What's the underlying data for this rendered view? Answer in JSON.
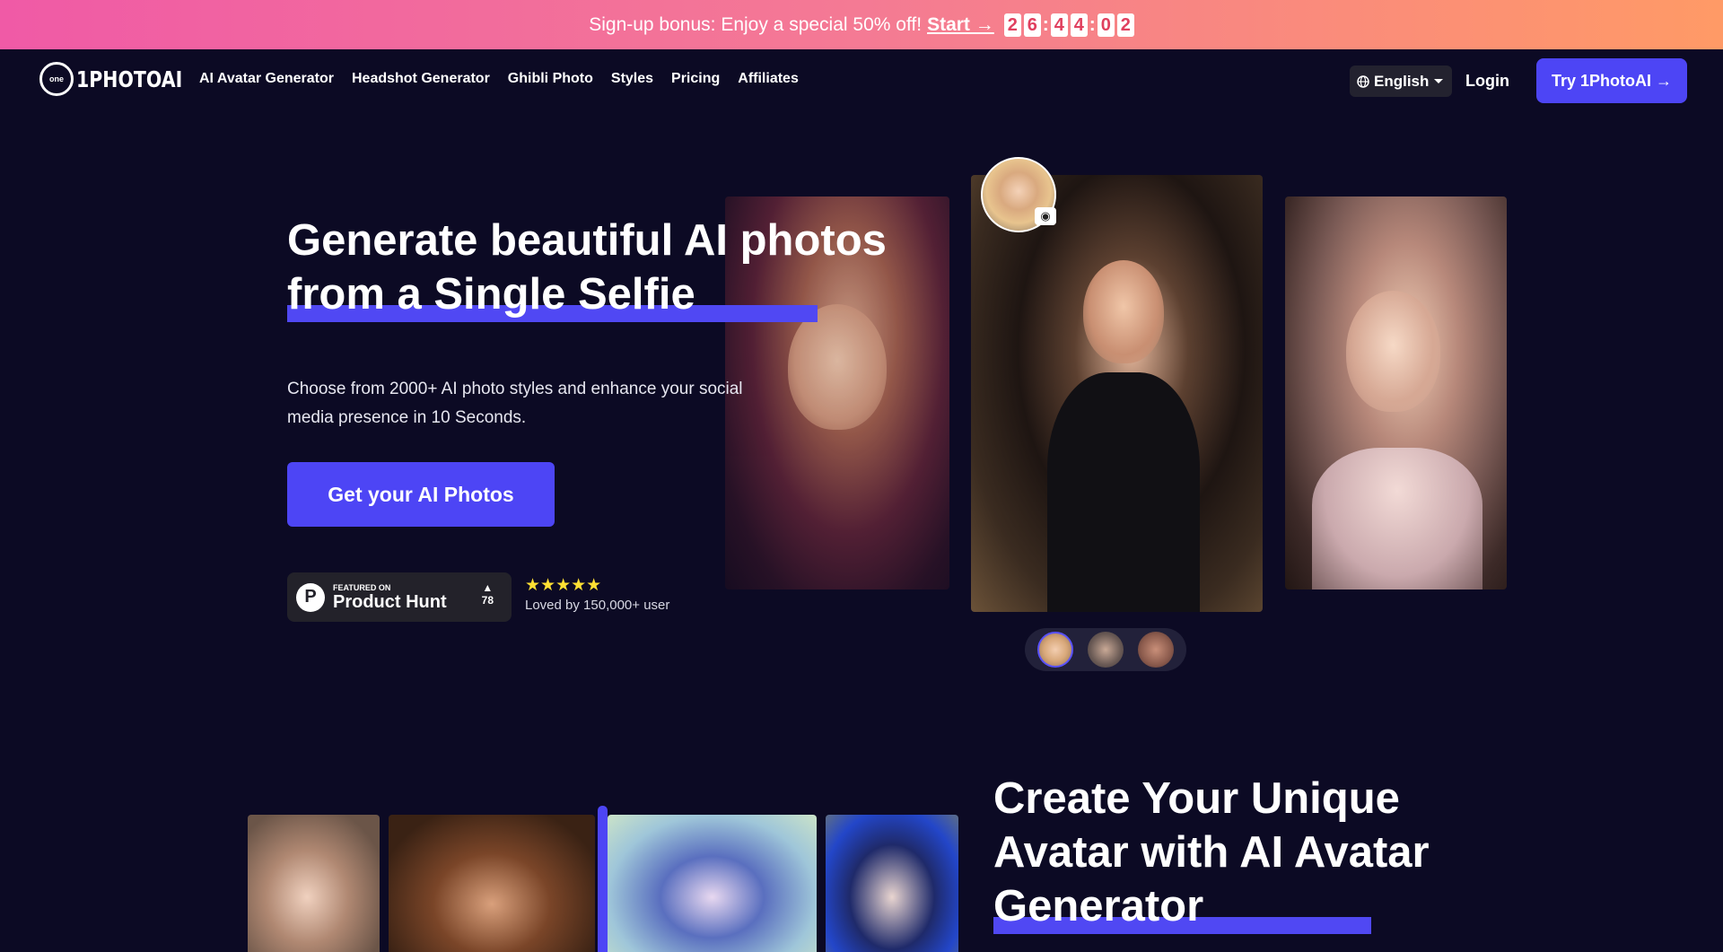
{
  "promo": {
    "text": "Sign-up bonus: Enjoy a special 50% off!",
    "start_label": "Start →",
    "countdown": [
      "2",
      "6",
      "4",
      "4",
      "0",
      "2"
    ]
  },
  "nav": {
    "logo_text": "1PHOTOAI",
    "logo_mark": "one",
    "links": [
      "AI Avatar Generator",
      "Headshot Generator",
      "Ghibli Photo",
      "Styles",
      "Pricing",
      "Affiliates"
    ],
    "language": "English",
    "login": "Login",
    "try_button": "Try 1PhotoAI →"
  },
  "hero": {
    "title_line1": "Generate beautiful AI photos",
    "title_line2": "from a Single Selfie",
    "subtitle": "Choose from 2000+ AI photo styles and enhance your social media presence in 10 Seconds.",
    "cta": "Get your AI Photos",
    "product_hunt": {
      "featured": "FEATURED ON",
      "name": "Product Hunt",
      "logo": "P",
      "upvote_icon": "▲",
      "count": "78"
    },
    "stars": "★★★★★",
    "loved": "Loved by 150,000+ user"
  },
  "section2": {
    "title_line1": "Create Your Unique",
    "title_line2": "Avatar with AI Avatar",
    "title_line3": "Generator"
  },
  "colors": {
    "background": "#0c0a24",
    "accent": "#4d45f5",
    "promo_gradient_start": "#f05aa6",
    "promo_gradient_end": "#ff9a66",
    "star": "#ffe033"
  }
}
